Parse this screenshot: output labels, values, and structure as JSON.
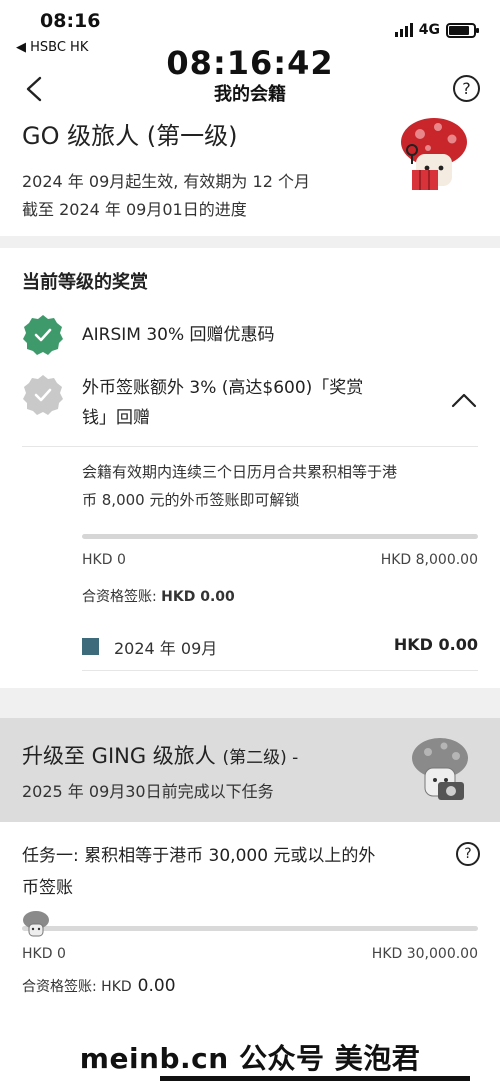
{
  "status_bar": {
    "time": "08:16",
    "back_app": "◀ HSBC HK",
    "network": "4G",
    "battery_level": 0.85
  },
  "overlay_time": "08:16:42",
  "header": {
    "title": "我的会籍",
    "help_glyph": "?"
  },
  "tier": {
    "name": "GO 级旅人 (第一级)",
    "effective_line": "2024 年 09月起生效, 有效期为 12 个月",
    "progress_line": "截至 2024 年 09月01日的进度"
  },
  "rewards": {
    "section_title": "当前等级的奖赏",
    "items": [
      {
        "label": "AIRSIM 30% 回赠优惠码",
        "unlocked": true
      },
      {
        "label_line1": "外币签账额外 3% (高达$600)「奖赏",
        "label_line2": "钱」回赠",
        "unlocked": false,
        "expanded": true
      }
    ],
    "detail": {
      "desc_line1": "会籍有效期内连续三个日历月合共累积相等于港",
      "desc_line2": "币 8,000 元的外币签账即可解锁",
      "progress": 0,
      "min_label": "HKD 0",
      "max_label": "HKD 8,000.00",
      "qualified_label": "合资格签账:",
      "qualified_value": "HKD 0.00",
      "month_label": "2024 年 09月",
      "month_value": "HKD 0.00"
    }
  },
  "upgrade": {
    "title_main": "升级至 GING 级旅人",
    "title_sub": "(第二级) -",
    "deadline": "2025 年 09月30日前完成以下任务"
  },
  "task": {
    "title_line1": "任务一: 累积相等于港币 30,000 元或以上的外",
    "title_line2": "币签账",
    "help_glyph": "?",
    "progress": 0,
    "min_label": "HKD 0",
    "max_label": "HKD 30,000.00",
    "qualified_label": "合资格签账: HKD",
    "qualified_value": "0.00"
  },
  "watermark": "meinb.cn 公众号 美泡君",
  "colors": {
    "badge_active": "#3f9a6b",
    "badge_inactive": "#c9c9c9",
    "progress_fill": "#4f7e8e",
    "month_swatch": "#3d6b7b",
    "banner_bg": "#dcdcdc"
  }
}
